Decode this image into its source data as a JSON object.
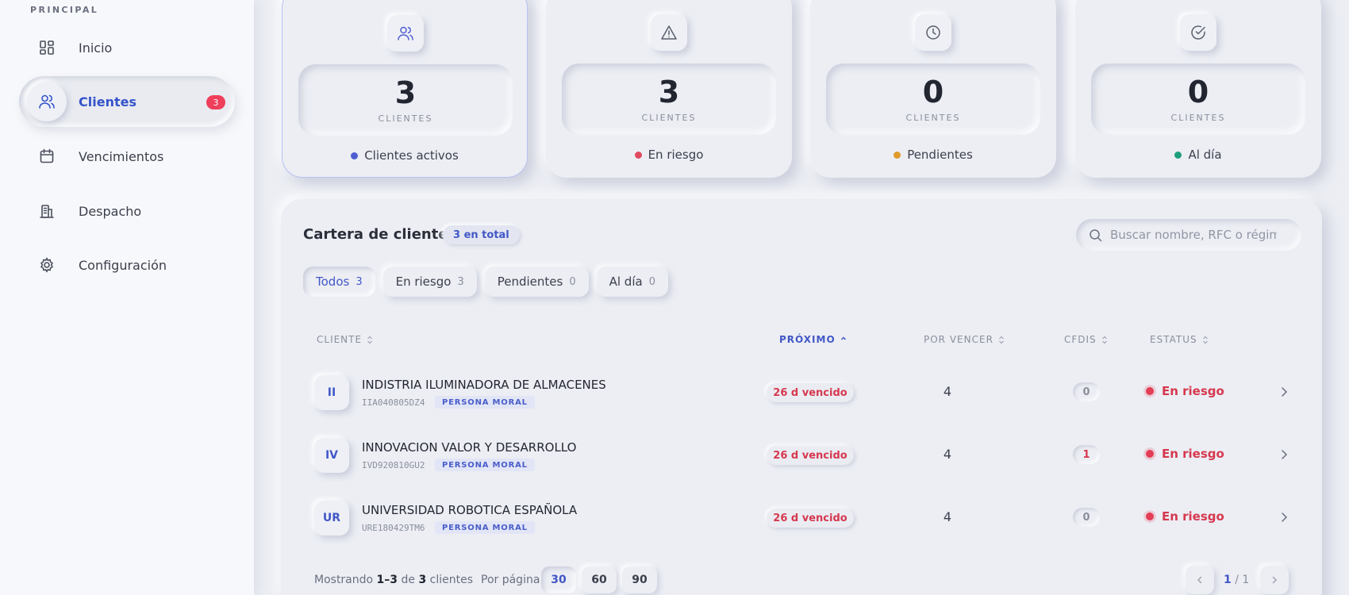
{
  "sidebar": {
    "section": "PRINCIPAL",
    "items": [
      {
        "label": "Inicio",
        "icon": "dashboard-icon"
      },
      {
        "label": "Clientes",
        "icon": "users-icon",
        "badge": "3"
      },
      {
        "label": "Vencimientos",
        "icon": "calendar-icon"
      },
      {
        "label": "Despacho",
        "icon": "building-icon"
      },
      {
        "label": "Configuración",
        "icon": "gear-icon"
      }
    ]
  },
  "stats": [
    {
      "value": "3",
      "unit": "CLIENTES",
      "caption": "Clientes activos",
      "color": "#4f5fd1",
      "icon": "users-icon"
    },
    {
      "value": "3",
      "unit": "CLIENTES",
      "caption": "En riesgo",
      "color": "#e14a5e",
      "icon": "warning-icon"
    },
    {
      "value": "0",
      "unit": "CLIENTES",
      "caption": "Pendientes",
      "color": "#e09a2a",
      "icon": "clock-icon"
    },
    {
      "value": "0",
      "unit": "CLIENTES",
      "caption": "Al día",
      "color": "#1f9e7e",
      "icon": "check-circle-icon"
    }
  ],
  "panel": {
    "title": "Cartera de clientes",
    "total_badge": "3 en total",
    "search_placeholder": "Buscar nombre, RFC o régimen",
    "filters": [
      {
        "label": "Todos",
        "count": "3"
      },
      {
        "label": "En riesgo",
        "count": "3"
      },
      {
        "label": "Pendientes",
        "count": "0"
      },
      {
        "label": "Al día",
        "count": "0"
      }
    ],
    "columns": {
      "cliente": "CLIENTE",
      "proximo": "PRÓXIMO",
      "por_vencer": "POR VENCER",
      "cfdis": "CFDIS",
      "estatus": "ESTATUS"
    },
    "rows": [
      {
        "initials": "II",
        "name": "INDISTRIA ILUMINADORA DE ALMACENES",
        "rfc": "IIA040805DZ4",
        "type": "PERSONA MORAL",
        "due": "26 d vencido",
        "por_vencer": "4",
        "cfdis": "0",
        "status": "En riesgo"
      },
      {
        "initials": "IV",
        "name": "INNOVACION VALOR Y DESARROLLO",
        "rfc": "IVD920810GU2",
        "type": "PERSONA MORAL",
        "due": "26 d vencido",
        "por_vencer": "4",
        "cfdis": "1",
        "status": "En riesgo"
      },
      {
        "initials": "UR",
        "name": "UNIVERSIDAD ROBOTICA ESPAÑOLA",
        "rfc": "URE180429TM6",
        "type": "PERSONA MORAL",
        "due": "26 d vencido",
        "por_vencer": "4",
        "cfdis": "0",
        "status": "En riesgo"
      }
    ],
    "footer": {
      "showing_prefix": "Mostrando",
      "showing_range": "1–3",
      "showing_of": "de",
      "showing_total": "3",
      "showing_suffix": "clientes",
      "per_page_label": "Por página",
      "page_sizes": [
        "30",
        "60",
        "90"
      ],
      "current_page": "1",
      "total_pages": "/ 1"
    }
  },
  "colors": {
    "accent": "#4257c6",
    "danger": "#d6384e",
    "background": "#eceef4"
  }
}
